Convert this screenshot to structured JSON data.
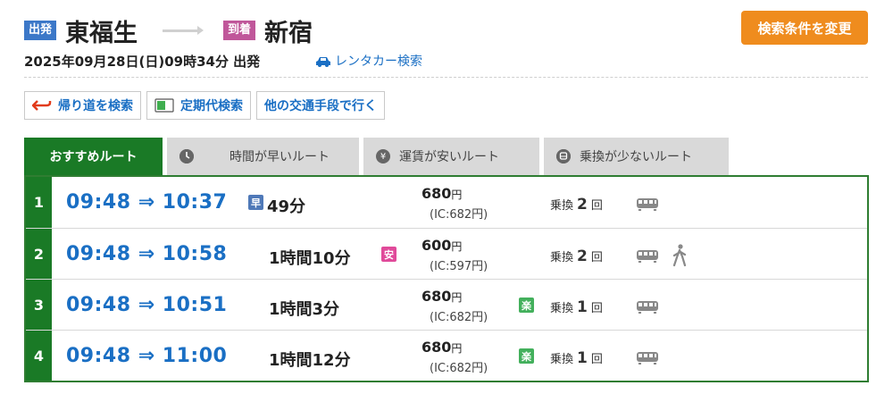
{
  "search": {
    "departure_badge": "出発",
    "departure_station": "東福生",
    "arrival_badge": "到着",
    "arrival_station": "新宿",
    "datetime": "2025年09月28日(日)09時34分 出発",
    "change_conditions": "検索条件を変更",
    "rentacar": "レンタカー検索"
  },
  "sub_buttons": [
    {
      "label": "帰り道を検索",
      "icon": "return-arrow-icon"
    },
    {
      "label": "定期代検索",
      "icon": "commuter-pass-icon"
    },
    {
      "label": "他の交通手段で行く",
      "icon": ""
    }
  ],
  "tabs": [
    {
      "label": "おすすめルート",
      "icon": ""
    },
    {
      "label": "時間が早いルート",
      "icon": "clock-icon"
    },
    {
      "label": "運賃が安いルート",
      "icon": "yen-icon"
    },
    {
      "label": "乗換が少ないルート",
      "icon": "transfer-icon"
    }
  ],
  "routes": [
    {
      "num": "1",
      "times": "09:48 ⇒ 10:37",
      "duration": "49分",
      "tag": "早",
      "price": "680",
      "price_unit": "円",
      "ic": "(IC:682円)",
      "transfer_label": "乗換",
      "transfers": "2",
      "transfer_unit": "回",
      "walk": false
    },
    {
      "num": "2",
      "times": "09:48 ⇒ 10:58",
      "duration": "1時間10分",
      "tag": "安",
      "price": "600",
      "price_unit": "円",
      "ic": "(IC:597円)",
      "transfer_label": "乗換",
      "transfers": "2",
      "transfer_unit": "回",
      "walk": true
    },
    {
      "num": "3",
      "times": "09:48 ⇒ 10:51",
      "duration": "1時間3分",
      "tag": "楽",
      "price": "680",
      "price_unit": "円",
      "ic": "(IC:682円)",
      "transfer_label": "乗換",
      "transfers": "1",
      "transfer_unit": "回",
      "walk": false
    },
    {
      "num": "4",
      "times": "09:48 ⇒ 11:00",
      "duration": "1時間12分",
      "tag": "楽",
      "price": "680",
      "price_unit": "円",
      "ic": "(IC:682円)",
      "transfer_label": "乗換",
      "transfers": "1",
      "transfer_unit": "回",
      "walk": false
    }
  ],
  "colors": {
    "accent_green": "#1a7a26",
    "link_blue": "#1a6fc4",
    "change_button": "#ef8c1e"
  }
}
